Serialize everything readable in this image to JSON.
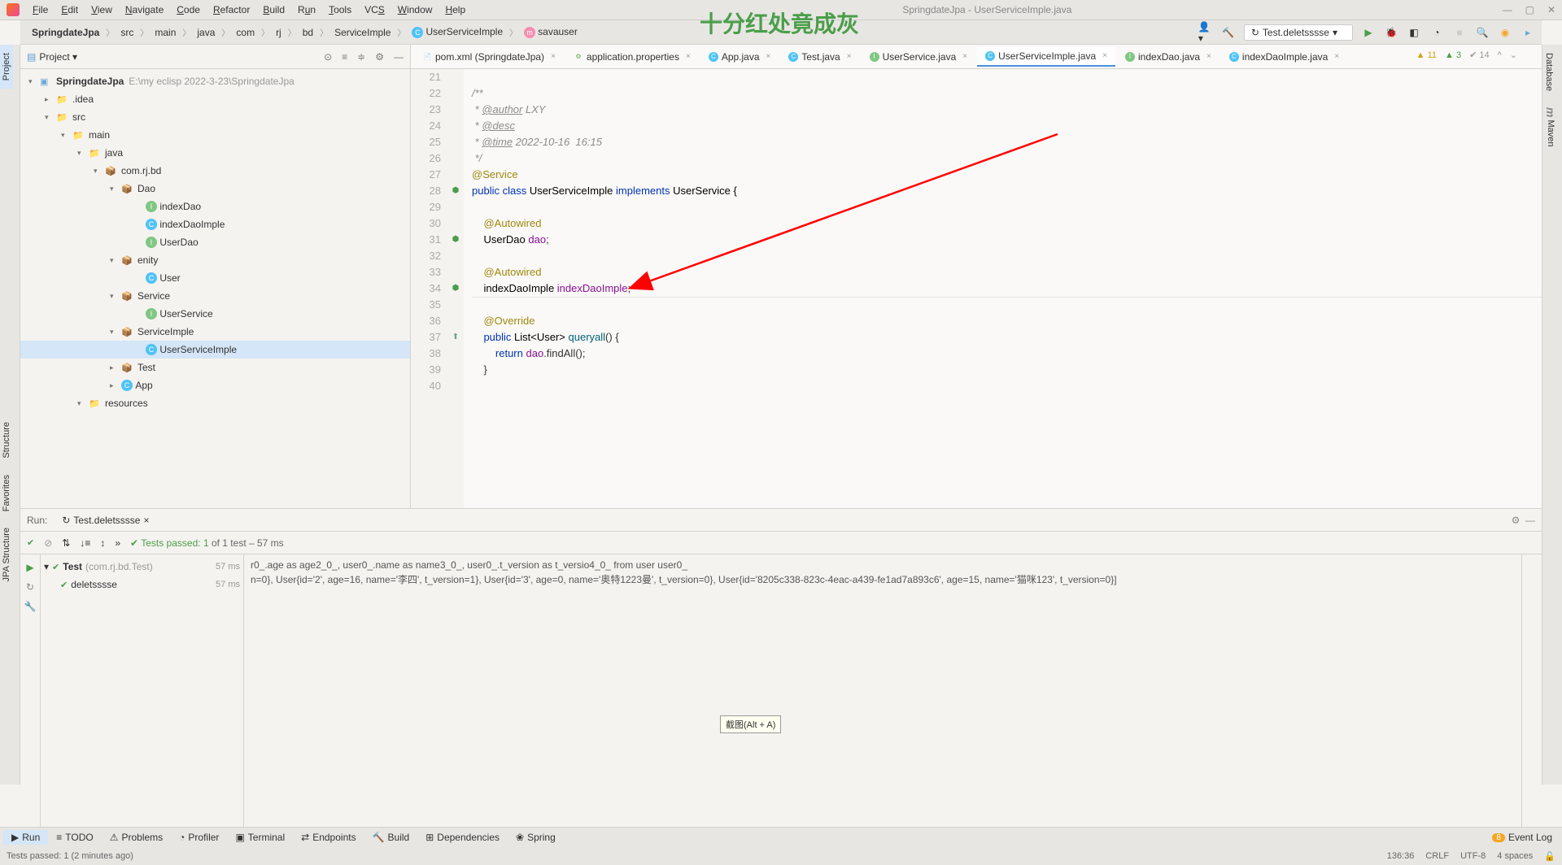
{
  "window": {
    "title": "SpringdateJpa - UserServiceImple.java"
  },
  "watermark": "十分红处竟成灰",
  "menu": [
    "File",
    "Edit",
    "View",
    "Navigate",
    "Code",
    "Refactor",
    "Build",
    "Run",
    "Tools",
    "VCS",
    "Window",
    "Help"
  ],
  "breadcrumbs": [
    "SpringdateJpa",
    "src",
    "main",
    "java",
    "com",
    "rj",
    "bd",
    "ServiceImple",
    "UserServiceImple",
    "savauser"
  ],
  "run_config": "Test.deletsssse",
  "project": {
    "header": "Project",
    "root": "SpringdateJpa",
    "root_hint": "E:\\my eclisp 2022-3-23\\SpringdateJpa",
    "nodes": {
      "idea": ".idea",
      "src": "src",
      "main": "main",
      "java": "java",
      "pkg": "com.rj.bd",
      "dao": "Dao",
      "indexDao": "indexDao",
      "indexDaoImple": "indexDaoImple",
      "userDao": "UserDao",
      "enity": "enity",
      "user": "User",
      "service": "Service",
      "userService": "UserService",
      "serviceImple": "ServiceImple",
      "userServiceImple": "UserServiceImple",
      "test": "Test",
      "app": "App",
      "resources": "resources"
    }
  },
  "tabs": [
    {
      "label": "pom.xml (SpringdateJpa)"
    },
    {
      "label": "application.properties"
    },
    {
      "label": "App.java"
    },
    {
      "label": "Test.java"
    },
    {
      "label": "UserService.java"
    },
    {
      "label": "UserServiceImple.java",
      "active": true
    },
    {
      "label": "indexDao.java"
    },
    {
      "label": "indexDaoImple.java"
    }
  ],
  "code": {
    "lines": {
      "l21": "21",
      "l22": "22",
      "l23": "23",
      "l24": "24",
      "l25": "25",
      "l26": "26",
      "l27": "27",
      "l28": "28",
      "l29": "29",
      "l30": "30",
      "l31": "31",
      "l32": "32",
      "l33": "33",
      "l34": "34",
      "l35": "35",
      "l36": "36",
      "l37": "37",
      "l38": "38",
      "l39": "39",
      "l40": "40"
    },
    "c22": "/**",
    "c23_pre": " * ",
    "c23_tag": "@author",
    "c23_post": " LXY",
    "c24_pre": " * ",
    "c24_tag": "@desc",
    "c25_pre": " * ",
    "c25_tag": "@time",
    "c25_post": " 2022-10-16  16:15",
    "c26": " */",
    "c27": "@Service",
    "c28_public": "public ",
    "c28_class": "class ",
    "c28_name": "UserServiceImple ",
    "c28_impl": "implements ",
    "c28_iface": "UserService {",
    "c30": "@Autowired",
    "c31_type": "UserDao ",
    "c31_field": "dao",
    "c31_end": ";",
    "c33": "@Autowired",
    "c34_type": "indexDaoImple ",
    "c34_field": "indexDaoImple",
    "c34_end": ";",
    "c36": "@Override",
    "c37_public": "public ",
    "c37_type": "List<User> ",
    "c37_method": "queryall",
    "c37_end": "() {",
    "c38_return": "return ",
    "c38_field": "dao",
    "c38_call": ".findAll();",
    "c39": "}"
  },
  "indicators": {
    "warn": "11",
    "ok": "3",
    "typo": "14"
  },
  "run": {
    "label": "Run:",
    "tab": "Test.deletsssse",
    "tests_pre": "Tests passed: ",
    "tests_count": "1",
    "tests_post": " of 1 test – 57 ms",
    "tree": {
      "root": "Test",
      "root_hint": "(com.rj.bd.Test)",
      "root_time": "57 ms",
      "child": "deletsssse",
      "child_time": "57 ms"
    },
    "console_l1": "r0_.age as age2_0_, user0_.name as name3_0_, user0_.t_version as t_versio4_0_ from user user0_",
    "console_l2": "n=0}, User{id='2', age=16, name='李四', t_version=1}, User{id='3', age=0, name='奥特1223曼', t_version=0}, User{id='8205c338-823c-4eac-a439-fe1ad7a893c6', age=15, name='猫咪123', t_version=0}]"
  },
  "tooltip": "截图(Alt + A)",
  "bottom": {
    "run": "Run",
    "todo": "TODO",
    "problems": "Problems",
    "profiler": "Profiler",
    "terminal": "Terminal",
    "endpoints": "Endpoints",
    "build": "Build",
    "dependencies": "Dependencies",
    "spring": "Spring",
    "eventlog": "Event Log",
    "event_count": "8"
  },
  "left_tabs": {
    "project": "Project",
    "structure": "Structure",
    "favorites": "Favorites",
    "jpa": "JPA Structure"
  },
  "right_tabs": {
    "database": "Database",
    "maven": "Maven"
  },
  "status": {
    "msg": "Tests passed: 1 (2 minutes ago)",
    "pos": "136:36",
    "crlf": "CRLF",
    "enc": "UTF-8",
    "indent": "4 spaces"
  }
}
